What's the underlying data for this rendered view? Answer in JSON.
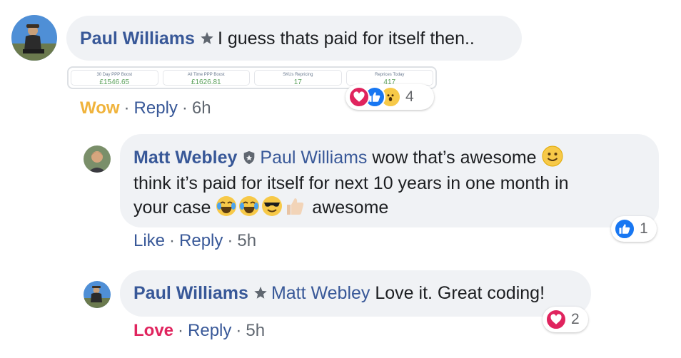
{
  "comments": [
    {
      "author": "Paul Williams",
      "badge": "top-fan-star-icon",
      "text": "I guess thats paid for itself then..",
      "reaction_label": "Wow",
      "reply_label": "Reply",
      "time": "6h",
      "reaction_count": "4",
      "reaction_icons": [
        "love-react-icon",
        "like-react-icon",
        "wow-react-icon"
      ],
      "stats": [
        {
          "label": "30 Day PPP Boost",
          "value": "£1546.65"
        },
        {
          "label": "All Time PPP Boost",
          "value": "£1626.81"
        },
        {
          "label": "SKUs Repricing",
          "value": "17"
        },
        {
          "label": "Reprices Today",
          "value": "417"
        }
      ]
    },
    {
      "author": "Matt Webley",
      "badge": "admin-shield-icon",
      "mention": "Paul Williams",
      "line1": "wow that’s awesome",
      "line2": "think it’s paid for itself for next 10 years in one month in",
      "line3_start": "your case",
      "line3_end": "awesome",
      "emojis": [
        "tears-of-joy-emoji",
        "tears-of-joy-emoji",
        "sunglasses-emoji",
        "thumbs-up-emoji"
      ],
      "like_label": "Like",
      "reply_label": "Reply",
      "time": "5h",
      "reaction_count": "1",
      "reaction_icons": [
        "like-react-icon"
      ]
    },
    {
      "author": "Paul Williams",
      "badge": "top-fan-star-icon",
      "mention": "Matt Webley",
      "text": "Love it. Great coding!",
      "reaction_label": "Love",
      "reply_label": "Reply",
      "time": "5h",
      "reaction_count": "2",
      "reaction_icons": [
        "love-react-icon"
      ]
    }
  ],
  "colors": {
    "author": "#385898",
    "bubble": "#f0f2f5",
    "wow": "#f0b33c",
    "love": "#e0245e",
    "like": "#1877f2",
    "meta": "#606770"
  }
}
